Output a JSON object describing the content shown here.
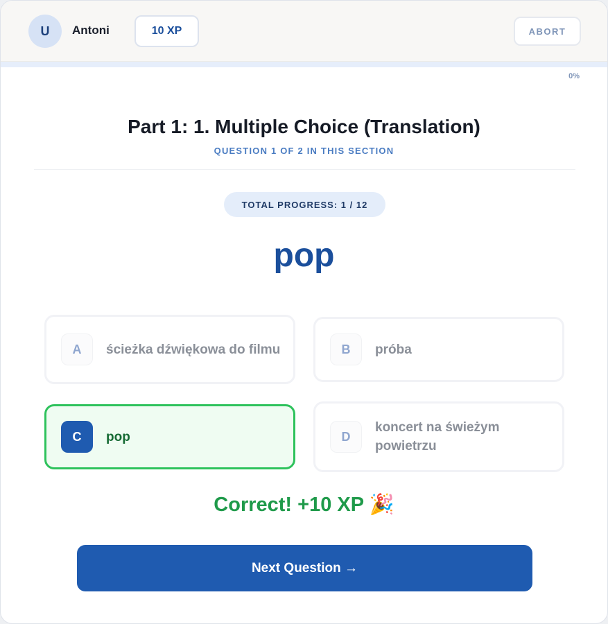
{
  "user": {
    "avatar_initial": "U",
    "name": "Antoni",
    "xp_label": "10 XP"
  },
  "header": {
    "abort_label": "ABORT"
  },
  "progress": {
    "percent_label": "0%",
    "percent_value": 0
  },
  "section": {
    "title": "Part 1: 1. Multiple Choice (Translation)",
    "subtitle": "QUESTION 1 OF 2 IN THIS SECTION",
    "total_progress": "TOTAL PROGRESS: 1 / 12"
  },
  "question": {
    "prompt": "pop"
  },
  "options": [
    {
      "letter": "A",
      "text": "ścieżka dźwiękowa do filmu",
      "state": "default"
    },
    {
      "letter": "B",
      "text": "próba",
      "state": "default"
    },
    {
      "letter": "C",
      "text": "pop",
      "state": "correct"
    },
    {
      "letter": "D",
      "text": "koncert na świeżym powietrzu",
      "state": "default"
    }
  ],
  "feedback": {
    "text": "Correct! +10 XP 🎉"
  },
  "next_button": {
    "label": "Next Question →"
  },
  "colors": {
    "accent": "#1f5bb0",
    "success": "#1f9a4a",
    "success_border": "#2ec25c",
    "success_bg": "#effcf2"
  }
}
